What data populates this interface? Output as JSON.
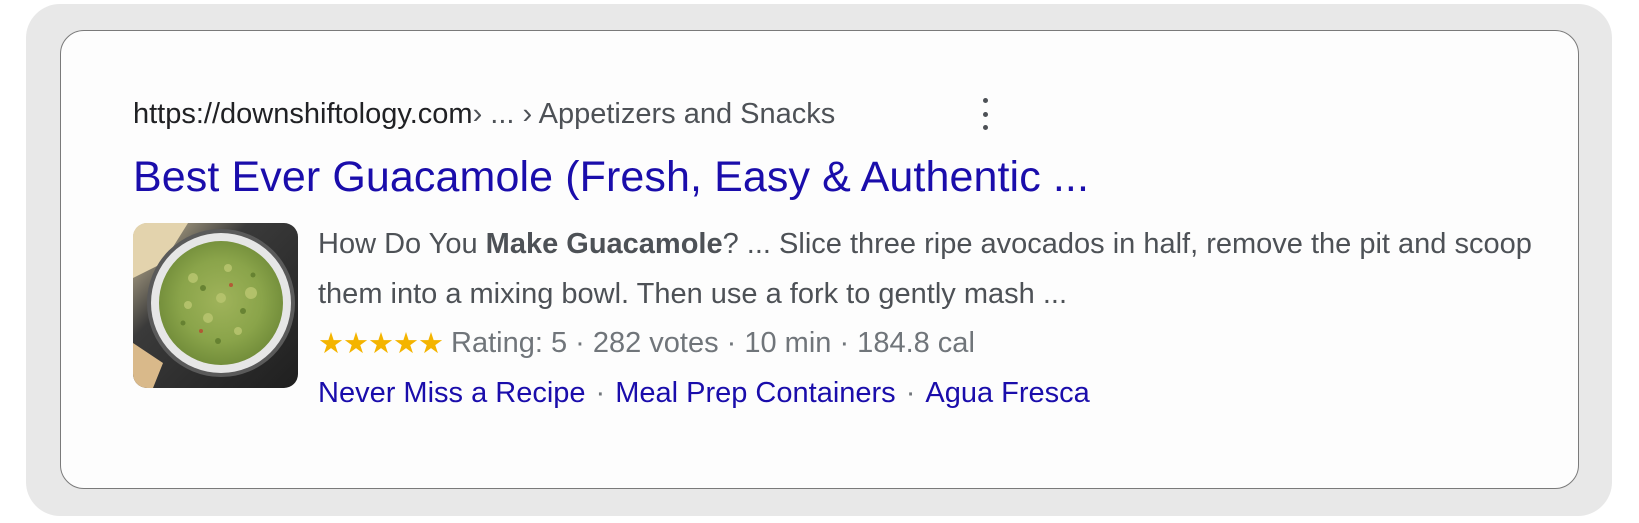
{
  "result": {
    "url": {
      "domain": "https://downshiftology.com",
      "path": " › ... › Appetizers and Snacks"
    },
    "more_icon": "more-vert-icon",
    "title": "Best Ever Guacamole (Fresh, Easy & Authentic ...",
    "thumbnail": "guacamole-bowl-image",
    "snippet": {
      "part1": "How Do You ",
      "bold": "Make Guacamole",
      "part2": "? ... Slice three ripe avocados in half, remove the pit and scoop them into a mixing bowl. Then use a fork to gently mash ..."
    },
    "rating": {
      "stars_text": "★★★★★",
      "stars_value": 5,
      "details": "Rating: 5 · 282 votes · 10 min · 184.8 cal"
    },
    "sitelinks": [
      "Never Miss a Recipe",
      "Meal Prep Containers",
      "Agua Fresca"
    ],
    "sitelink_separator": "·"
  },
  "colors": {
    "link": "#1a0dab",
    "text": "#4d5156",
    "muted": "#70757a",
    "star": "#f4b400"
  }
}
